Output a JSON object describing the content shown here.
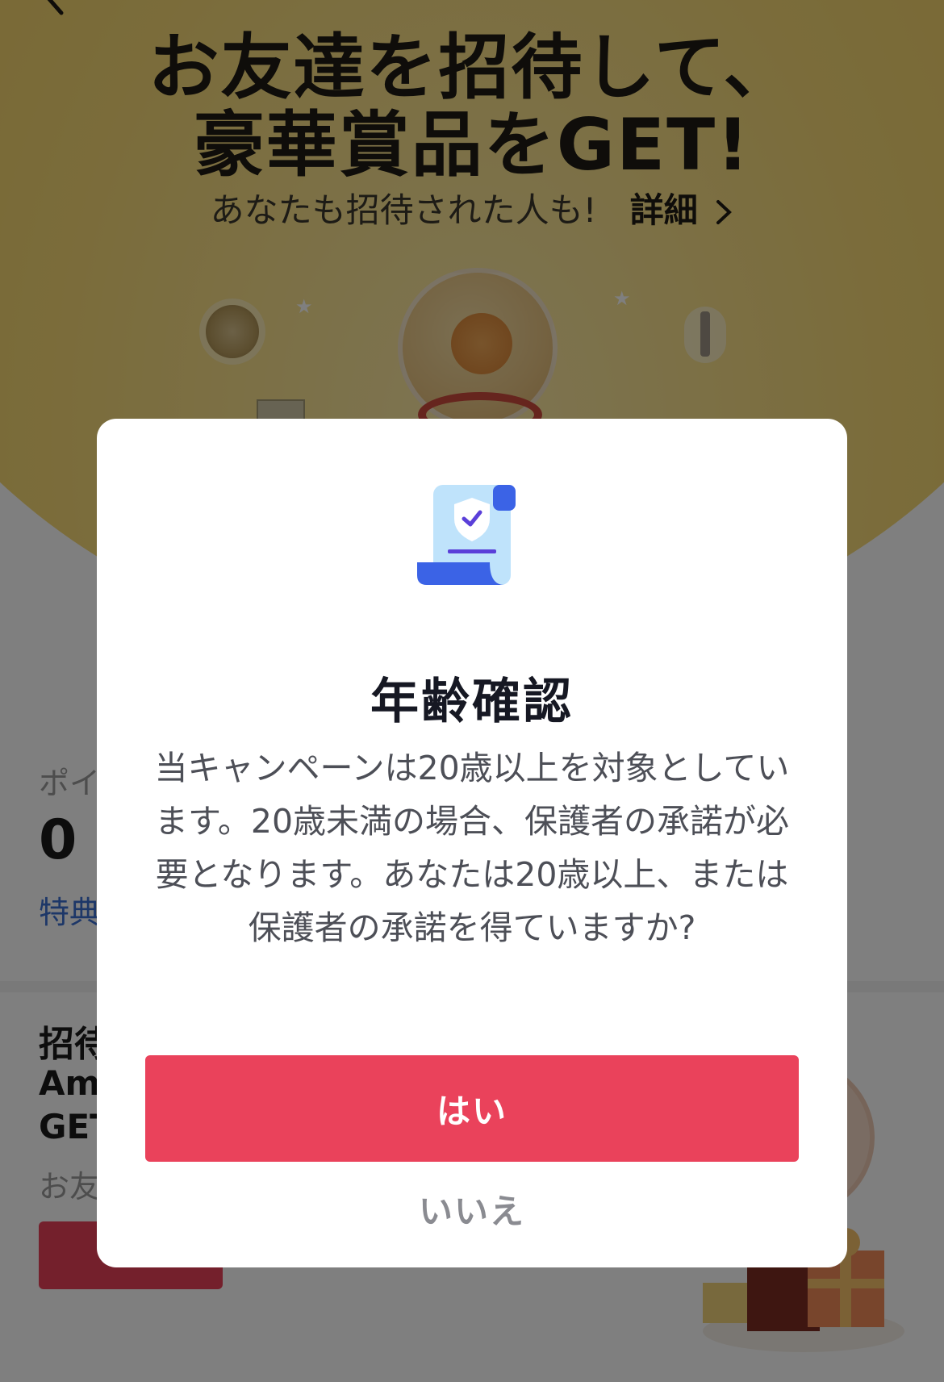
{
  "hero": {
    "title_line1": "お友達を招待して、",
    "title_line2": "豪華賞品をGET!",
    "subtitle": "あなたも招待された人も!",
    "detail_link": "詳細"
  },
  "points": {
    "label": "ポイ",
    "value": "0",
    "benefit_link": "特典"
  },
  "invite_card": {
    "title": "招待",
    "line1": "Ama",
    "line2": "GET",
    "description": "お友"
  },
  "modal": {
    "title": "年齢確認",
    "body": "当キャンペーンは20歳以上を対象としています。20歳未満の場合、保護者の承諾が必要となります。あなたは20歳以上、または保護者の承諾を得ていますか?",
    "yes_label": "はい",
    "no_label": "いいえ"
  },
  "colors": {
    "accent": "#ea425b",
    "scrim": "rgba(0,0,0,0.5)",
    "hero_gold": "#f6d976",
    "icon_blue": "#3b63e6",
    "icon_light_blue": "#bfe3fb"
  },
  "icons": {
    "back": "chevron-left-icon",
    "detail": "chevron-right-icon",
    "modal": "certificate-shield-check-icon"
  }
}
